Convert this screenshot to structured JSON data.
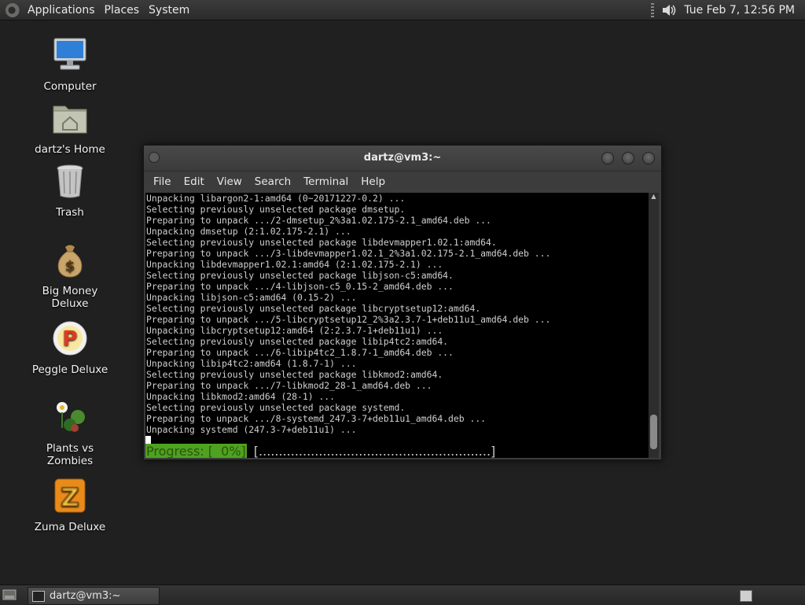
{
  "top_panel": {
    "menus": [
      "Applications",
      "Places",
      "System"
    ],
    "clock": "Tue Feb  7, 12:56 PM"
  },
  "desktop_icons": [
    {
      "label": "Computer",
      "icon": "computer-icon"
    },
    {
      "label": "dartz's Home",
      "icon": "home-folder-icon"
    },
    {
      "label": "Trash",
      "icon": "trash-icon"
    },
    {
      "label": "Big Money Deluxe",
      "icon": "money-bag-icon"
    },
    {
      "label": "Peggle Deluxe",
      "icon": "peggle-icon"
    },
    {
      "label": "Plants vs Zombies",
      "icon": "plants-vs-zombies-icon"
    },
    {
      "label": "Zuma Deluxe",
      "icon": "zuma-icon"
    }
  ],
  "terminal": {
    "title": "dartz@vm3:~",
    "menus": [
      "File",
      "Edit",
      "View",
      "Search",
      "Terminal",
      "Help"
    ],
    "lines": [
      "Unpacking libargon2-1:amd64 (0~20171227-0.2) ...",
      "Selecting previously unselected package dmsetup.",
      "Preparing to unpack .../2-dmsetup_2%3a1.02.175-2.1_amd64.deb ...",
      "Unpacking dmsetup (2:1.02.175-2.1) ...",
      "Selecting previously unselected package libdevmapper1.02.1:amd64.",
      "Preparing to unpack .../3-libdevmapper1.02.1_2%3a1.02.175-2.1_amd64.deb ...",
      "Unpacking libdevmapper1.02.1:amd64 (2:1.02.175-2.1) ...",
      "Selecting previously unselected package libjson-c5:amd64.",
      "Preparing to unpack .../4-libjson-c5_0.15-2_amd64.deb ...",
      "Unpacking libjson-c5:amd64 (0.15-2) ...",
      "Selecting previously unselected package libcryptsetup12:amd64.",
      "Preparing to unpack .../5-libcryptsetup12_2%3a2.3.7-1+deb11u1_amd64.deb ...",
      "Unpacking libcryptsetup12:amd64 (2:2.3.7-1+deb11u1) ...",
      "Selecting previously unselected package libip4tc2:amd64.",
      "Preparing to unpack .../6-libip4tc2_1.8.7-1_amd64.deb ...",
      "Unpacking libip4tc2:amd64 (1.8.7-1) ...",
      "Selecting previously unselected package libkmod2:amd64.",
      "Preparing to unpack .../7-libkmod2_28-1_amd64.deb ...",
      "Unpacking libkmod2:amd64 (28-1) ...",
      "Selecting previously unselected package systemd.",
      "Preparing to unpack .../8-systemd_247.3-7+deb11u1_amd64.deb ...",
      "Unpacking systemd (247.3-7+deb11u1) ..."
    ],
    "progress_label": "Progress: [  0%]",
    "progress_track": "[..........................................................]",
    "progress_percent": 0
  },
  "taskbar": {
    "task_label": "dartz@vm3:~"
  },
  "colors": {
    "progress_green": "#4ea21f",
    "desktop_bg": "#1f201f"
  }
}
